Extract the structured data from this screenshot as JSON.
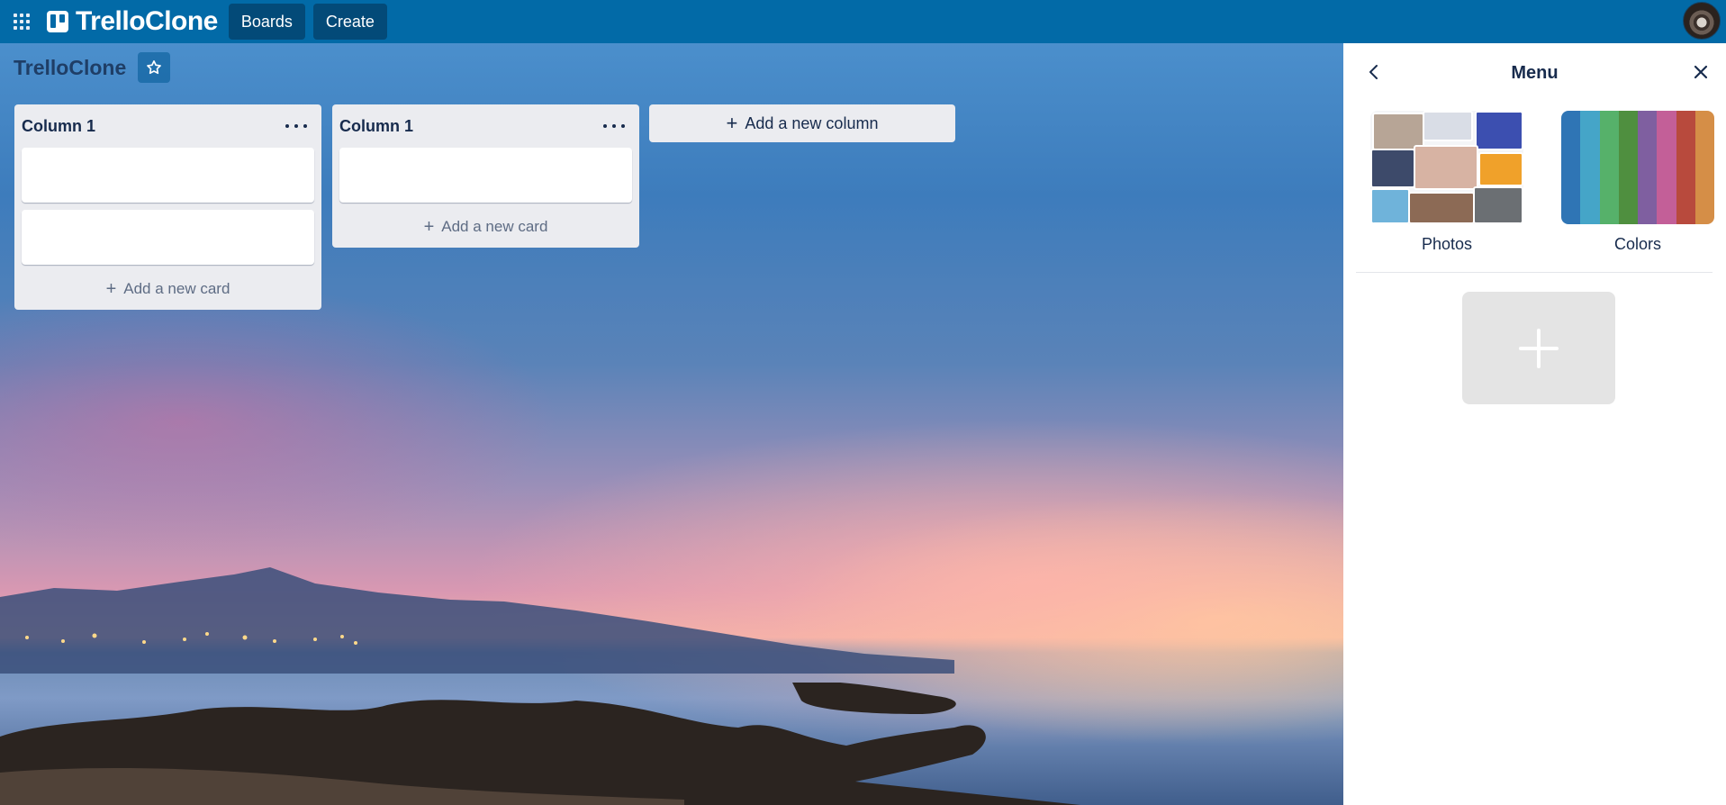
{
  "topbar": {
    "app_name": "TrelloClone",
    "boards_label": "Boards",
    "create_label": "Create"
  },
  "board": {
    "title": "TrelloClone",
    "add_column_label": "Add a new column",
    "columns": [
      {
        "title": "Column 1",
        "card_count": 2,
        "add_card_label": "Add a new card"
      },
      {
        "title": "Column 1",
        "card_count": 1,
        "add_card_label": "Add a new card"
      }
    ]
  },
  "menu": {
    "title": "Menu",
    "options": [
      {
        "label": "Photos"
      },
      {
        "label": "Colors"
      }
    ],
    "color_swatches": [
      "#2f75b5",
      "#45a5c8",
      "#56b16a",
      "#4f8f3f",
      "#7f5fa0",
      "#c35f98",
      "#b84a3d",
      "#d58e47"
    ]
  },
  "colors": {
    "nav_bg": "#026aa7",
    "nav_button_bg": "#034a78",
    "column_bg": "#ebecf0"
  }
}
